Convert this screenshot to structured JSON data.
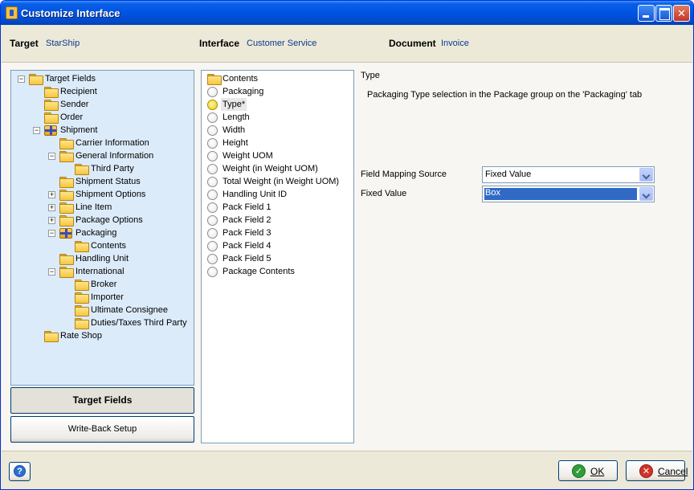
{
  "window": {
    "title": "Customize Interface",
    "title_icon": "app-icon"
  },
  "header": {
    "target_label": "Target",
    "target_value": "StarShip",
    "interface_label": "Interface",
    "interface_value": "Customer Service",
    "document_label": "Document",
    "document_value": "Invoice"
  },
  "tree": {
    "items": [
      {
        "label": "Target Fields",
        "expander": "−"
      },
      {
        "label": "Recipient"
      },
      {
        "label": "Sender"
      },
      {
        "label": "Order"
      },
      {
        "label": "Shipment",
        "expander": "−",
        "icon": "package-icon"
      },
      {
        "label": "Carrier Information"
      },
      {
        "label": "General Information",
        "expander": "−"
      },
      {
        "label": "Third Party"
      },
      {
        "label": "Shipment Status"
      },
      {
        "label": "Shipment Options",
        "expander": "+"
      },
      {
        "label": "Line Item",
        "expander": "+"
      },
      {
        "label": "Package Options",
        "expander": "+"
      },
      {
        "label": "Packaging",
        "expander": "−",
        "icon": "package-icon"
      },
      {
        "label": "Contents"
      },
      {
        "label": "Handling Unit"
      },
      {
        "label": "International",
        "expander": "−"
      },
      {
        "label": "Broker"
      },
      {
        "label": "Importer"
      },
      {
        "label": "Ultimate Consignee"
      },
      {
        "label": "Duties/Taxes Third Party"
      },
      {
        "label": "Rate Shop"
      }
    ]
  },
  "side_buttons": {
    "target_fields": "Target Fields",
    "write_back_setup": "Write-Back Setup"
  },
  "fields": {
    "folder_label": "Contents",
    "items": [
      {
        "label": "Packaging"
      },
      {
        "label": "Type*",
        "selected": true
      },
      {
        "label": "Length"
      },
      {
        "label": "Width"
      },
      {
        "label": "Height"
      },
      {
        "label": "Weight UOM"
      },
      {
        "label": "Weight (in Weight UOM)"
      },
      {
        "label": "Total Weight (in Weight UOM)"
      },
      {
        "label": "Handling Unit ID"
      },
      {
        "label": "Pack Field 1"
      },
      {
        "label": "Pack Field 2"
      },
      {
        "label": "Pack Field 3"
      },
      {
        "label": "Pack Field 4"
      },
      {
        "label": "Pack Field 5"
      },
      {
        "label": "Package Contents"
      }
    ]
  },
  "detail": {
    "heading": "Type",
    "description": "Packaging Type selection in the Package group on the 'Packaging' tab",
    "mapping_source_label": "Field Mapping Source",
    "mapping_source_value": "Fixed Value",
    "fixed_value_label": "Fixed Value",
    "fixed_value_value": "Box"
  },
  "footer": {
    "ok_label": "OK",
    "cancel_label": "Cancel",
    "help_icon": "?",
    "ok_icon": "✓",
    "cancel_icon": "✕"
  },
  "colors": {
    "titlebar": "#0054e3",
    "tree_background": "#dcebfa",
    "selection": "#316ac5",
    "value_text": "#0b3a8c"
  }
}
